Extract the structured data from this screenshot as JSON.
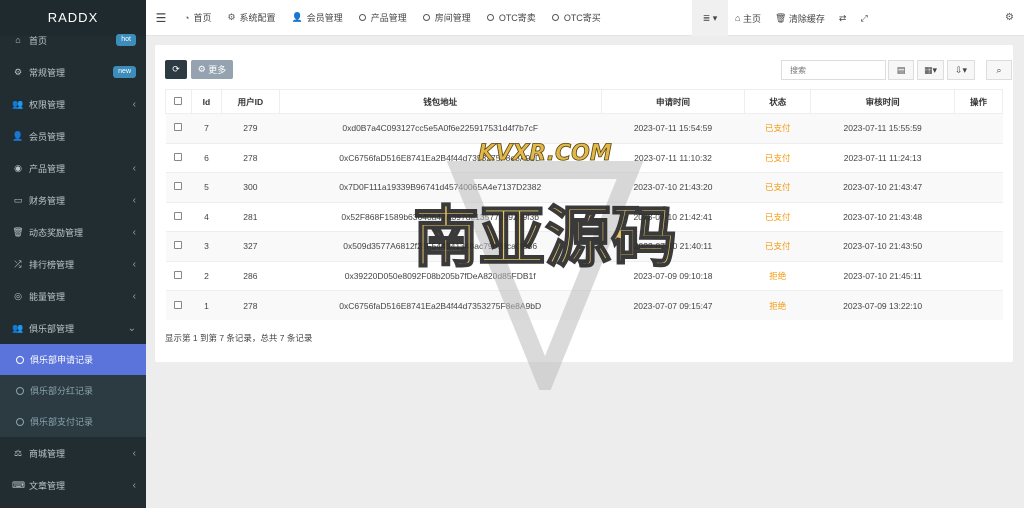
{
  "brand": "RADDX",
  "sidebar": {
    "items": [
      {
        "label": "首页",
        "icon": "home-icon",
        "glyph": "⌂",
        "badge": "hot"
      },
      {
        "label": "常规管理",
        "icon": "cogs-icon",
        "glyph": "⚙",
        "badge": "new"
      },
      {
        "label": "权限管理",
        "icon": "users-icon",
        "glyph": "👥",
        "caret": "‹"
      },
      {
        "label": "会员管理",
        "icon": "user-icon",
        "glyph": "👤"
      },
      {
        "label": "产品管理",
        "icon": "product-icon",
        "glyph": "◉",
        "caret": "‹"
      },
      {
        "label": "财务管理",
        "icon": "credit-card-icon",
        "glyph": "▭",
        "caret": "‹"
      },
      {
        "label": "动态奖励管理",
        "icon": "trash-icon",
        "glyph": "🗑",
        "caret": "‹"
      },
      {
        "label": "排行榜管理",
        "icon": "random-icon",
        "glyph": "⤮",
        "caret": "‹"
      },
      {
        "label": "能量管理",
        "icon": "target-icon",
        "glyph": "◎",
        "caret": "‹"
      },
      {
        "label": "俱乐部管理",
        "icon": "users-icon",
        "glyph": "👥",
        "caret": "⌄"
      }
    ],
    "sub_items": [
      {
        "label": "俱乐部申请记录",
        "active": true
      },
      {
        "label": "俱乐部分红记录"
      },
      {
        "label": "俱乐部支付记录"
      }
    ],
    "bottom_items": [
      {
        "label": "商城管理",
        "icon": "balance-scale-icon",
        "glyph": "⚖",
        "caret": "‹"
      },
      {
        "label": "文章管理",
        "icon": "keyboard-icon",
        "glyph": "⌨",
        "caret": "‹"
      }
    ]
  },
  "topbar": {
    "nav": [
      {
        "label": "首页",
        "icon": "dashboard-icon",
        "glyph": "◔"
      },
      {
        "label": "系统配置",
        "icon": "gear-icon",
        "glyph": "⚙"
      },
      {
        "label": "会员管理",
        "icon": "user-icon",
        "glyph": "👤"
      },
      {
        "label": "产品管理",
        "icon": "circle-icon"
      },
      {
        "label": "房间管理",
        "icon": "circle-icon"
      },
      {
        "label": "OTC寄卖",
        "icon": "circle-icon"
      },
      {
        "label": "OTC寄买",
        "icon": "circle-icon"
      }
    ],
    "right": {
      "home_label": "主页",
      "clear_cache_label": "清除缓存"
    }
  },
  "toolbar": {
    "more_label": "更多",
    "search_placeholder": "搜索"
  },
  "table": {
    "columns": [
      "",
      "Id",
      "用户ID",
      "钱包地址",
      "申请时间",
      "状态",
      "审核时间",
      "操作"
    ],
    "rows": [
      {
        "id": "7",
        "user_id": "279",
        "wallet": "0xd0B7a4C093127cc5e5A0f6e225917531d4f7b7cF",
        "apply_time": "2023-07-11 15:54:59",
        "status": "已支付",
        "review_time": "2023-07-11 15:55:59"
      },
      {
        "id": "6",
        "user_id": "278",
        "wallet": "0xC6756faD516E8741Ea2B4f44d7353275F8e8A9bD",
        "apply_time": "2023-07-11 11:10:32",
        "status": "已支付",
        "review_time": "2023-07-11 11:24:13"
      },
      {
        "id": "5",
        "user_id": "300",
        "wallet": "0x7D0F111a19339B96741d45740065A4e7137D2382",
        "apply_time": "2023-07-10 21:43:20",
        "status": "已支付",
        "review_time": "2023-07-10 21:43:47"
      },
      {
        "id": "4",
        "user_id": "281",
        "wallet": "0x52F868F1589b63640a47A397de13577059269f3b",
        "apply_time": "2023-07-10 21:42:41",
        "status": "已支付",
        "review_time": "2023-07-10 21:43:48"
      },
      {
        "id": "3",
        "user_id": "327",
        "wallet": "0x509d3577A6812f25F544941348ac790d8ca0f636",
        "apply_time": "2023-07-10 21:40:11",
        "status": "已支付",
        "review_time": "2023-07-10 21:43:50"
      },
      {
        "id": "2",
        "user_id": "286",
        "wallet": "0x39220D050e8092F08b205b7fDeA820d85FDB1f",
        "apply_time": "2023-07-09 09:10:18",
        "status": "拒绝",
        "review_time": "2023-07-10 21:45:11"
      },
      {
        "id": "1",
        "user_id": "278",
        "wallet": "0xC6756faD516E8741Ea2B4f44d7353275F8e8A9bD",
        "apply_time": "2023-07-07 09:15:47",
        "status": "拒绝",
        "review_time": "2023-07-09 13:22:10"
      }
    ]
  },
  "pagination_info": "显示第 1 到第 7 条记录，总共 7 条记录",
  "watermark": {
    "site": "KVXR.COM",
    "title": "南亚源码"
  },
  "colors": {
    "sidebar": "#222d32",
    "active": "#5b74dc",
    "status": "#f39c12"
  }
}
